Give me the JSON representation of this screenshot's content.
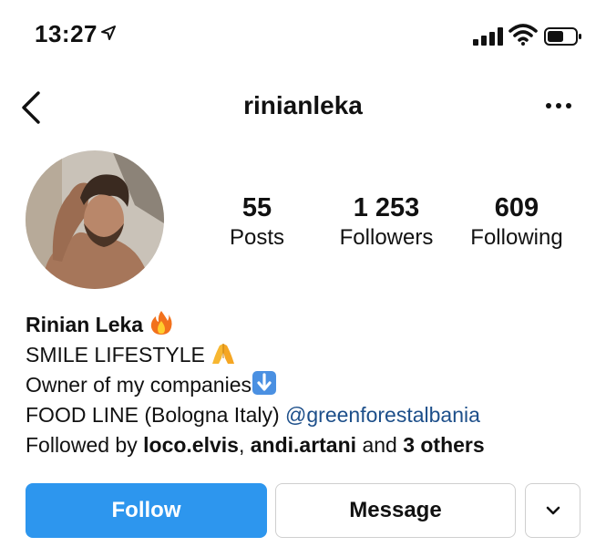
{
  "status_bar": {
    "time": "13:27",
    "icons": [
      "location-arrow-icon",
      "signal-bars-icon",
      "wifi-icon",
      "battery-icon"
    ]
  },
  "nav": {
    "username": "rinianleka",
    "back_icon": "chevron-left-icon",
    "more_icon": "ellipsis-icon"
  },
  "profile": {
    "stats": [
      {
        "value": "55",
        "label": "Posts"
      },
      {
        "value": "1 253",
        "label": "Followers"
      },
      {
        "value": "609",
        "label": "Following"
      }
    ],
    "name": "Rinian Leka",
    "bio": {
      "line1": "SMILE LIFESTYLE",
      "line2": "Owner of my companies",
      "line3_text": " FOOD LINE (Bologna Italy)",
      "line3_mention": "@greenforestalbania"
    },
    "followed_by": {
      "prefix": "Followed by",
      "user1": "loco.elvis",
      "separator": ",",
      "user2": "andi.artani",
      "and": "and",
      "others": "3 others"
    }
  },
  "actions": {
    "follow": "Follow",
    "message": "Message",
    "dropdown_icon": "chevron-down-icon"
  },
  "colors": {
    "follow_button": "#2d96ee",
    "mention": "#1d4f8a",
    "border": "#cfcfcf"
  }
}
